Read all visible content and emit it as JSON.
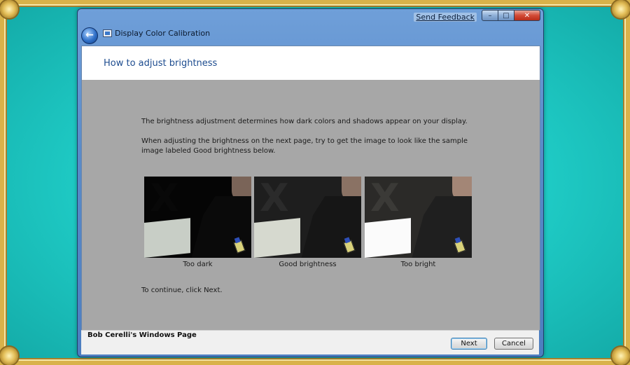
{
  "window": {
    "title": "Display Color Calibration",
    "send_feedback": "Send Feedback",
    "controls": {
      "minimize": "–",
      "maximize": "□",
      "close": "✕"
    },
    "back_glyph": "←"
  },
  "page": {
    "heading": "How to adjust brightness",
    "paragraph1": "The brightness adjustment determines how dark colors and shadows appear on your display.",
    "paragraph2": "When adjusting the brightness on the next page, try to get the image to look like the sample image labeled Good brightness below.",
    "samples": [
      {
        "caption": "Too dark",
        "mark": "X"
      },
      {
        "caption": "Good brightness",
        "mark": "X"
      },
      {
        "caption": "Too bright",
        "mark": "X"
      }
    ],
    "continue_text": "To continue, click Next."
  },
  "footer": {
    "label": "Bob Cerelli's Windows Page",
    "next": "Next",
    "cancel": "Cancel"
  },
  "colors": {
    "backdrop": "#1fc9c4",
    "frame_gold": "#d9b24a",
    "window_chrome": "#5a8bc9",
    "content_gray": "#a7a7a7",
    "heading_blue": "#1d4c8f"
  },
  "icons": [
    "back-arrow-icon",
    "display-calibration-icon",
    "minimize-icon",
    "maximize-icon",
    "close-icon"
  ]
}
